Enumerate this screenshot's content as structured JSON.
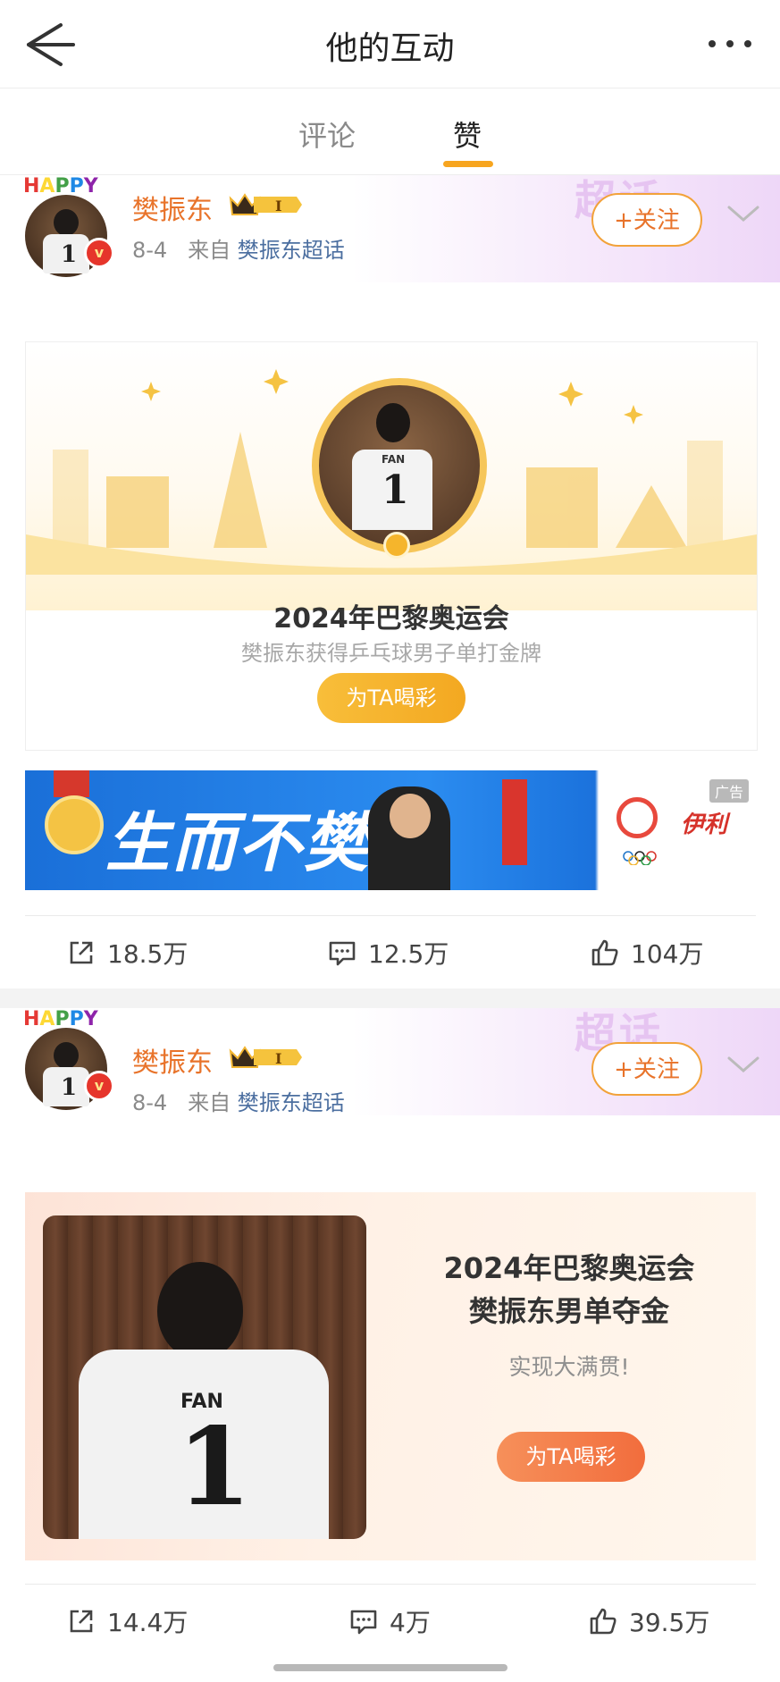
{
  "header": {
    "title": "他的互动"
  },
  "tabs": [
    {
      "label": "评论",
      "active": false
    },
    {
      "label": "赞",
      "active": true
    }
  ],
  "posts": [
    {
      "user": {
        "name": "樊振东",
        "avatar_decoration": "HAPPY"
      },
      "meta": {
        "date": "8-4",
        "from_prefix": "来自",
        "source": "樊振东超话"
      },
      "follow_label": "+关注",
      "card": {
        "title": "2024年巴黎奥运会",
        "subtitle": "樊振东获得乒乓球男子单打金牌",
        "cheer_label": "为TA喝彩"
      },
      "ad": {
        "slogan": "生而不樊",
        "tag": "广告",
        "brand": "伊利"
      },
      "stats": {
        "share": "18.5万",
        "comment": "12.5万",
        "like": "104万"
      }
    },
    {
      "user": {
        "name": "樊振东",
        "avatar_decoration": "HAPPY"
      },
      "meta": {
        "date": "8-4",
        "from_prefix": "来自",
        "source": "樊振东超话"
      },
      "follow_label": "+关注",
      "card": {
        "title_line1": "2024年巴黎奥运会",
        "title_line2": "樊振东男单夺金",
        "subtitle": "实现大满贯!",
        "cheer_label": "为TA喝彩"
      },
      "stats": {
        "share": "14.4万",
        "comment": "4万",
        "like": "39.5万"
      }
    }
  ],
  "colors": {
    "accent": "#f7a51f",
    "username": "#e8732a",
    "source_link": "#4c6fa0"
  }
}
